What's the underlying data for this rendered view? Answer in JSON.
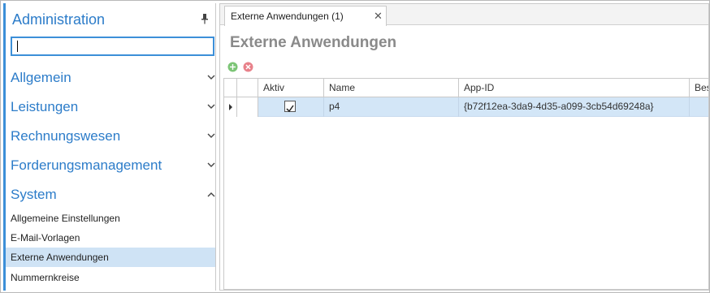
{
  "sidebar": {
    "title": "Administration",
    "search_value": "",
    "sections": [
      {
        "label": "Allgemein",
        "expanded": false
      },
      {
        "label": "Leistungen",
        "expanded": false
      },
      {
        "label": "Rechnungswesen",
        "expanded": false
      },
      {
        "label": "Forderungsmanagement",
        "expanded": false
      },
      {
        "label": "System",
        "expanded": true
      }
    ],
    "system_items": [
      {
        "label": "Allgemeine Einstellungen",
        "active": false
      },
      {
        "label": "E-Mail-Vorlagen",
        "active": false
      },
      {
        "label": "Externe Anwendungen",
        "active": true
      },
      {
        "label": "Nummernkreise",
        "active": false
      }
    ]
  },
  "tabs": [
    {
      "label": "Externe Anwendungen (1)",
      "close": "✕"
    }
  ],
  "page": {
    "title": "Externe Anwendungen"
  },
  "grid": {
    "columns": [
      "Aktiv",
      "Name",
      "App-ID",
      "Bes"
    ],
    "rows": [
      {
        "aktiv": true,
        "name": "p4",
        "app_id": "{b72f12ea-3da9-4d35-a099-3cb54d69248a}",
        "bes": ""
      }
    ]
  },
  "colors": {
    "accent": "#2c7cc9",
    "selection": "#d3e6f7",
    "add_icon": "#7cc576",
    "delete_icon": "#e8818a"
  }
}
